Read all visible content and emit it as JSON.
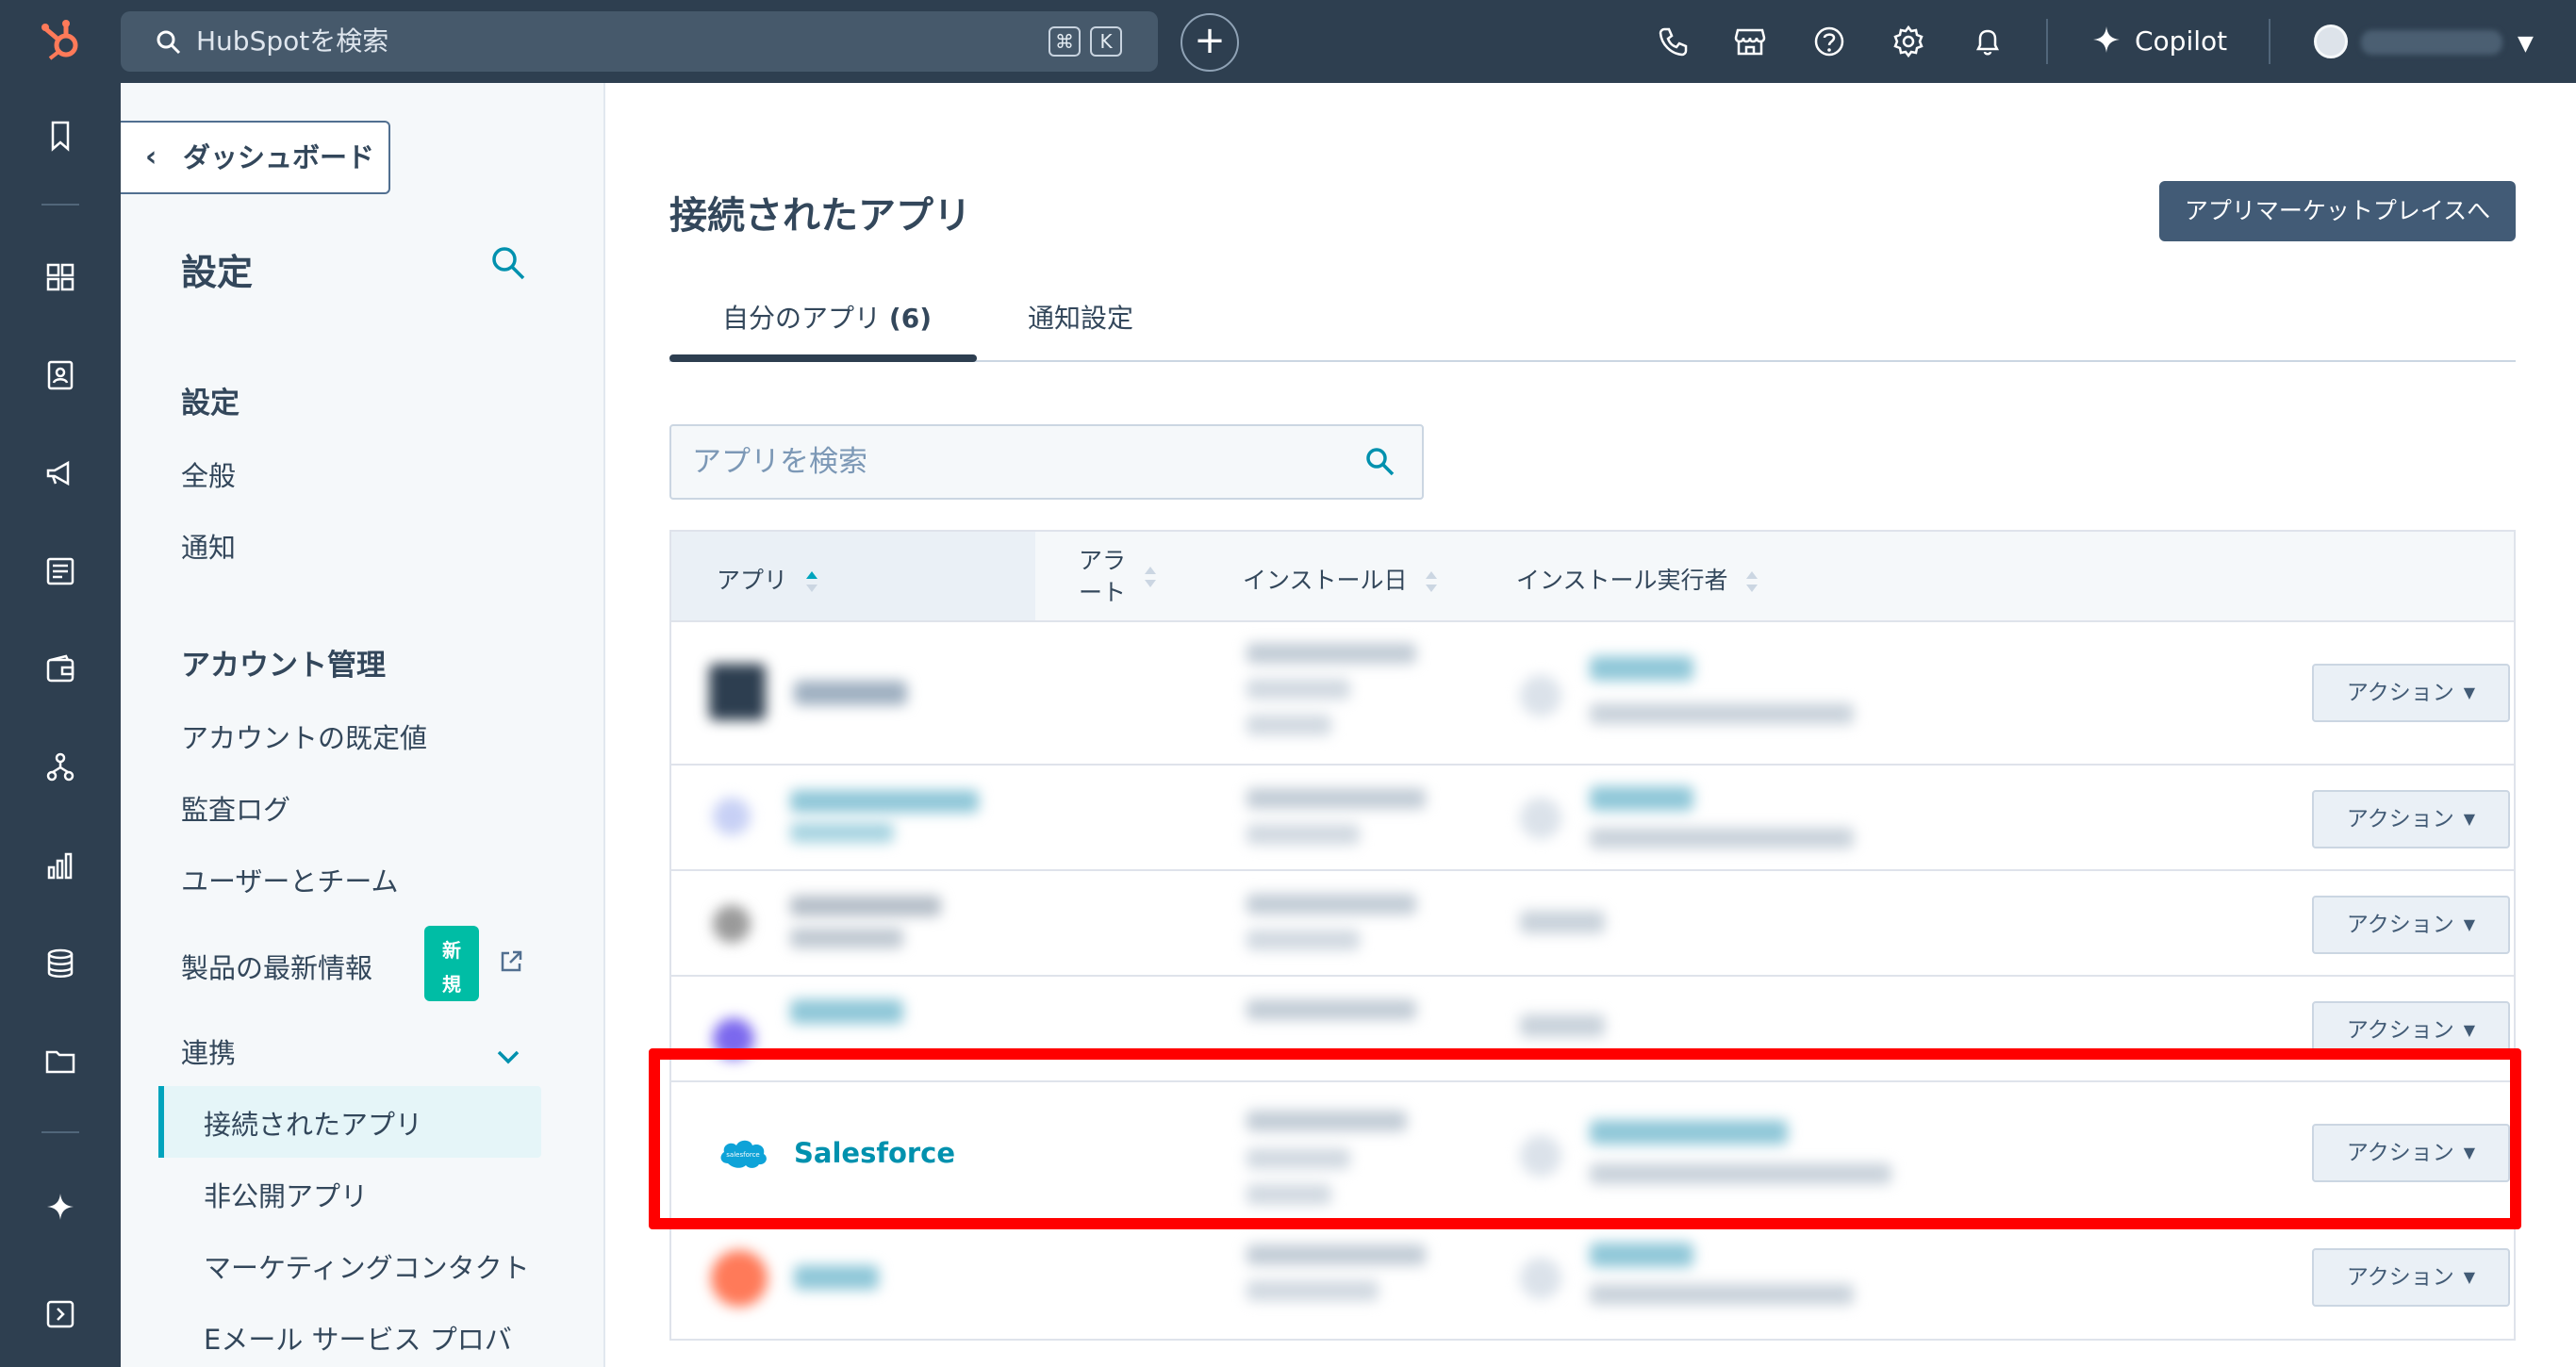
{
  "topbar": {
    "search_placeholder": "HubSpotを検索",
    "shortcut_cmd": "⌘",
    "shortcut_key": "K",
    "plus": "+",
    "copilot_label": "Copilot",
    "icons": [
      "phone-icon",
      "marketplace-icon",
      "help-icon",
      "settings-icon",
      "notifications-icon"
    ]
  },
  "rail": {
    "icons": [
      "bookmark-icon",
      "workspaces-icon",
      "contacts-icon",
      "marketing-icon",
      "content-icon",
      "commerce-icon",
      "automation-icon",
      "reporting-icon",
      "data-icon",
      "library-icon",
      "copilot-icon",
      "expand-icon"
    ]
  },
  "sidebar": {
    "back_label": "ダッシュボード",
    "title": "設定",
    "section_settings": "設定",
    "general": "全般",
    "notifications": "通知",
    "section_account": "アカウント管理",
    "account_defaults": "アカウントの既定値",
    "audit_log": "監査ログ",
    "users_teams": "ユーザーとチーム",
    "product_updates": "製品の最新情報",
    "new_badge_1": "新",
    "new_badge_2": "規",
    "integrations": "連携",
    "connected_apps": "接続されたアプリ",
    "private_apps": "非公開アプリ",
    "marketing_contacts": "マーケティングコンタクト",
    "email_provider": "Eメール サービス プロバ"
  },
  "main": {
    "title": "接続されたアプリ",
    "marketplace_button": "アプリマーケットプレイスへ",
    "tab_my_apps": "自分のアプリ",
    "tab_my_apps_count": "(6)",
    "tab_notifications": "通知設定",
    "search_placeholder": "アプリを検索",
    "columns": {
      "app": "アプリ",
      "alerts_1": "アラ",
      "alerts_2": "ート",
      "install_date": "インストール日",
      "installer": "インストール実行者"
    },
    "action_label": "アクション",
    "highlight_app": "Salesforce",
    "salesforce_logo_text": "salesforce"
  },
  "colors": {
    "topbar": "#2e3f50",
    "accent": "#00a4bd",
    "highlight": "#ff0000",
    "badge": "#00bda5"
  }
}
